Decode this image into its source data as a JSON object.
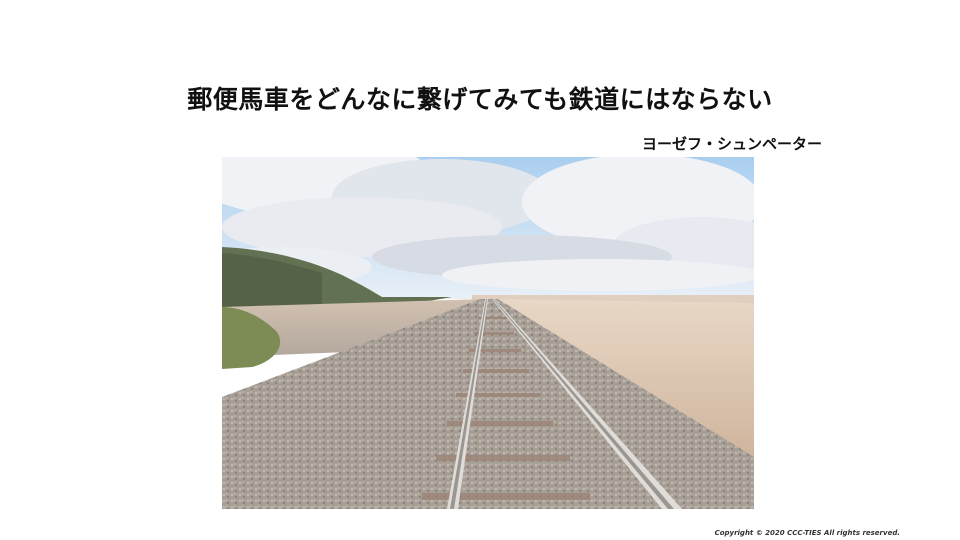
{
  "slide": {
    "title": "郵便馬車をどんなに繋げてみても鉄道にはならない",
    "author": "ヨーゼフ・シュンペーター",
    "copyright": "Copyright © 2020  CCC-TIES All rights reserved."
  },
  "photo": {
    "colors": {
      "sky_blue": "#a9cff0",
      "cloud": "#eef1f5",
      "cloud_shadow": "#c9d0da",
      "hill": "#4d5e3a",
      "lake": "#d8c3b0",
      "sand": "#e3cdb4",
      "ballast": "#9f958a",
      "rail": "#d8d4cf",
      "sleeper": "#8e7565"
    }
  }
}
